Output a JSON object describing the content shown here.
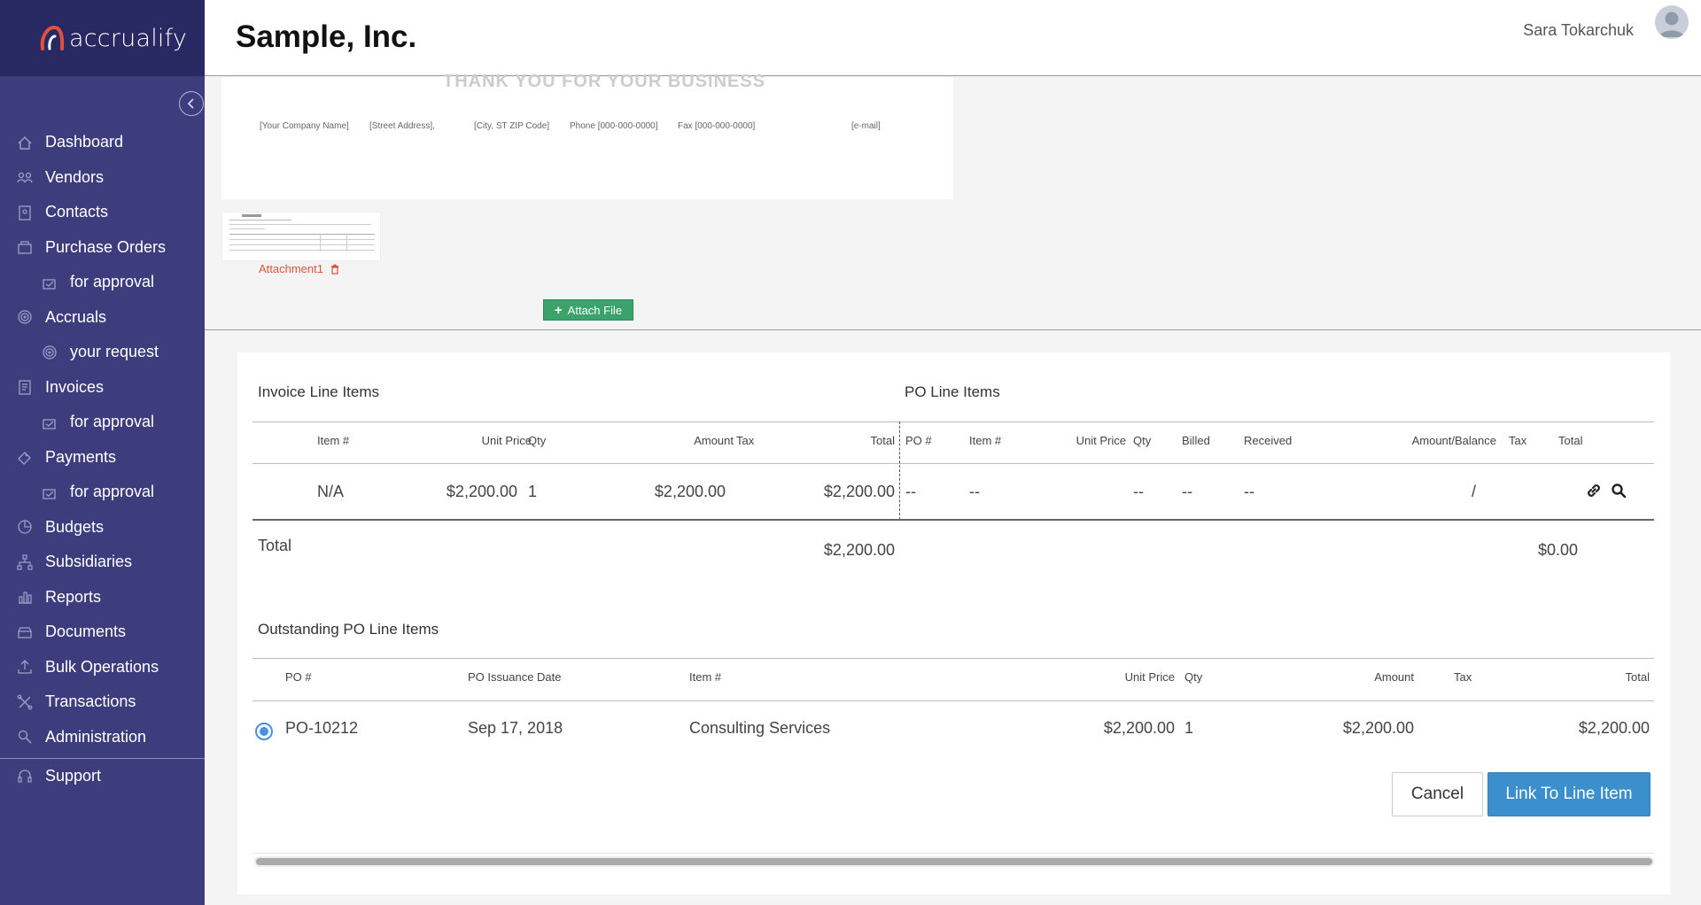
{
  "app": {
    "logo_text": "accrualify"
  },
  "header": {
    "company": "Sample, Inc.",
    "user_name": "Sara Tokarchuk"
  },
  "sidebar": {
    "items": [
      {
        "label": "Dashboard",
        "icon": "home-icon",
        "sub": false
      },
      {
        "label": "Vendors",
        "icon": "vendors-icon",
        "sub": false
      },
      {
        "label": "Contacts",
        "icon": "contacts-icon",
        "sub": false
      },
      {
        "label": "Purchase Orders",
        "icon": "purchase-orders-icon",
        "sub": false
      },
      {
        "label": "for approval",
        "icon": "approval-icon",
        "sub": true
      },
      {
        "label": "Accruals",
        "icon": "accruals-icon",
        "sub": false
      },
      {
        "label": "your request",
        "icon": "request-icon",
        "sub": true
      },
      {
        "label": "Invoices",
        "icon": "invoices-icon",
        "sub": false
      },
      {
        "label": "for approval",
        "icon": "approval-icon",
        "sub": true
      },
      {
        "label": "Payments",
        "icon": "payments-icon",
        "sub": false
      },
      {
        "label": "for approval",
        "icon": "approval-icon",
        "sub": true
      },
      {
        "label": "Budgets",
        "icon": "budgets-icon",
        "sub": false
      },
      {
        "label": "Subsidiaries",
        "icon": "subsidiaries-icon",
        "sub": false
      },
      {
        "label": "Reports",
        "icon": "reports-icon",
        "sub": false
      },
      {
        "label": "Documents",
        "icon": "documents-icon",
        "sub": false
      },
      {
        "label": "Bulk Operations",
        "icon": "bulk-operations-icon",
        "sub": false
      },
      {
        "label": "Transactions",
        "icon": "transactions-icon",
        "sub": false
      },
      {
        "label": "Administration",
        "icon": "administration-icon",
        "sub": false
      }
    ],
    "support": "Support"
  },
  "preview": {
    "thanks": "THANK YOU FOR YOUR BUSINESS",
    "footer": [
      "[Your Company Name]",
      "[Street Address],",
      "[City, ST ZIP Code]",
      "Phone [000-000-0000]",
      "Fax [000-000-0000]",
      "[e-mail]"
    ],
    "attachment_label": "Attachment1",
    "attach_button": "Attach File"
  },
  "invoice_section": {
    "title": "Invoice Line Items",
    "headers": {
      "item": "Item #",
      "unit_price": "Unit Price",
      "qty": "Qty",
      "amount": "Amount",
      "tax": "Tax",
      "total": "Total"
    },
    "row": {
      "item": "N/A",
      "unit_price": "$2,200.00",
      "qty": "1",
      "amount": "$2,200.00",
      "tax": "",
      "total": "$2,200.00"
    },
    "total_label": "Total",
    "total_value": "$2,200.00"
  },
  "po_section": {
    "title": "PO Line Items",
    "headers": {
      "po": "PO #",
      "item": "Item #",
      "unit_price": "Unit Price",
      "qty": "Qty",
      "billed": "Billed",
      "received": "Received",
      "amount_balance": "Amount/Balance",
      "tax": "Tax",
      "total": "Total"
    },
    "row": {
      "po": "--",
      "item": "--",
      "qty": "--",
      "billed": "--",
      "received": "--",
      "amount_balance": "/"
    },
    "total_value": "$0.00"
  },
  "outstanding": {
    "title": "Outstanding PO Line Items",
    "headers": {
      "po": "PO #",
      "date": "PO Issuance Date",
      "item": "Item #",
      "unit_price": "Unit Price",
      "qty": "Qty",
      "amount": "Amount",
      "tax": "Tax",
      "total": "Total"
    },
    "row": {
      "po": "PO-10212",
      "date": "Sep 17, 2018",
      "item": "Consulting Services",
      "unit_price": "$2,200.00",
      "qty": "1",
      "amount": "$2,200.00",
      "tax": "",
      "total": "$2,200.00"
    }
  },
  "actions": {
    "cancel": "Cancel",
    "link": "Link To Line Item"
  },
  "colors": {
    "sidebar": "#3d3d7e",
    "logo_bar": "#282862",
    "primary": "#3b8fcc",
    "attach": "#3aa36b",
    "attachment_red": "#e2513b"
  }
}
